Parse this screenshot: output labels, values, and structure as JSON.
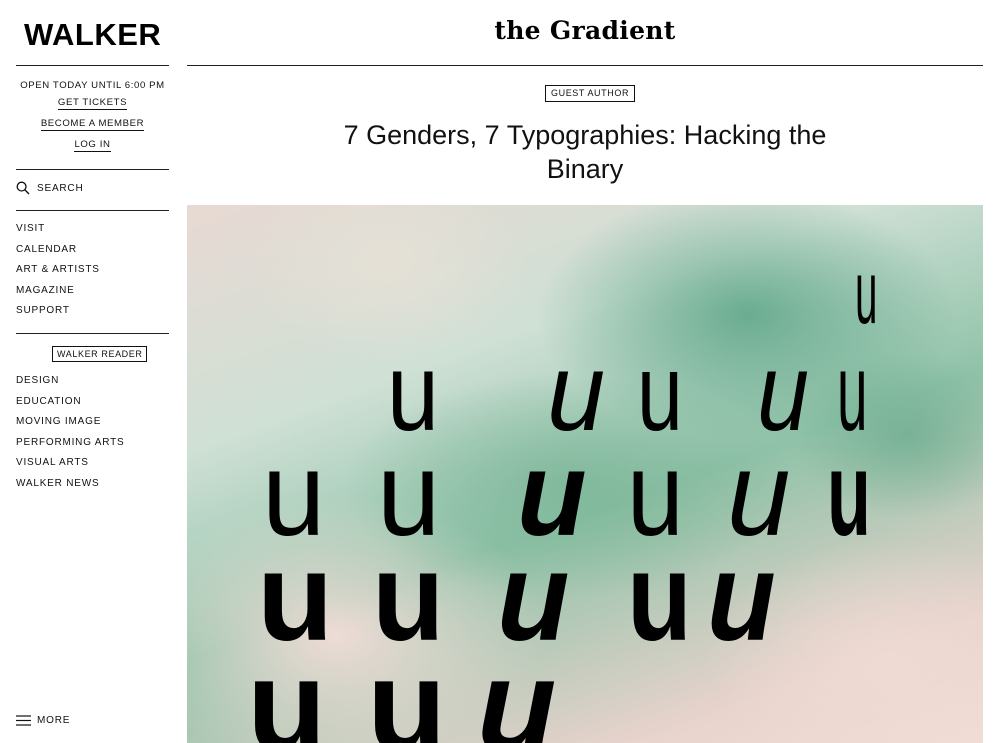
{
  "sidebar": {
    "logo": "WALKER",
    "hours": "OPEN TODAY UNTIL 6:00 PM",
    "links": {
      "tickets": "GET TICKETS",
      "member": "BECOME A MEMBER",
      "login": "LOG IN"
    },
    "search_label": "SEARCH",
    "nav_main": [
      "VISIT",
      "CALENDAR",
      "ART & ARTISTS",
      "MAGAZINE",
      "SUPPORT"
    ],
    "reader_label": "WALKER READER",
    "nav_reader": [
      "DESIGN",
      "EDUCATION",
      "MOVING IMAGE",
      "PERFORMING ARTS",
      "VISUAL ARTS",
      "WALKER NEWS"
    ],
    "more_label": "MORE"
  },
  "header": {
    "section_logo": "the Gradient"
  },
  "article": {
    "badge": "GUEST AUTHOR",
    "title_line1": "7 Genders, 7 Typographies: Hacking the",
    "title_line2": "Binary",
    "hero_glyph": "u"
  },
  "icons": {
    "search": "search-icon",
    "menu": "menu-icon"
  },
  "colors": {
    "text": "#111111",
    "hero_green": "#5ca587",
    "hero_pink": "#f3ddd8"
  }
}
